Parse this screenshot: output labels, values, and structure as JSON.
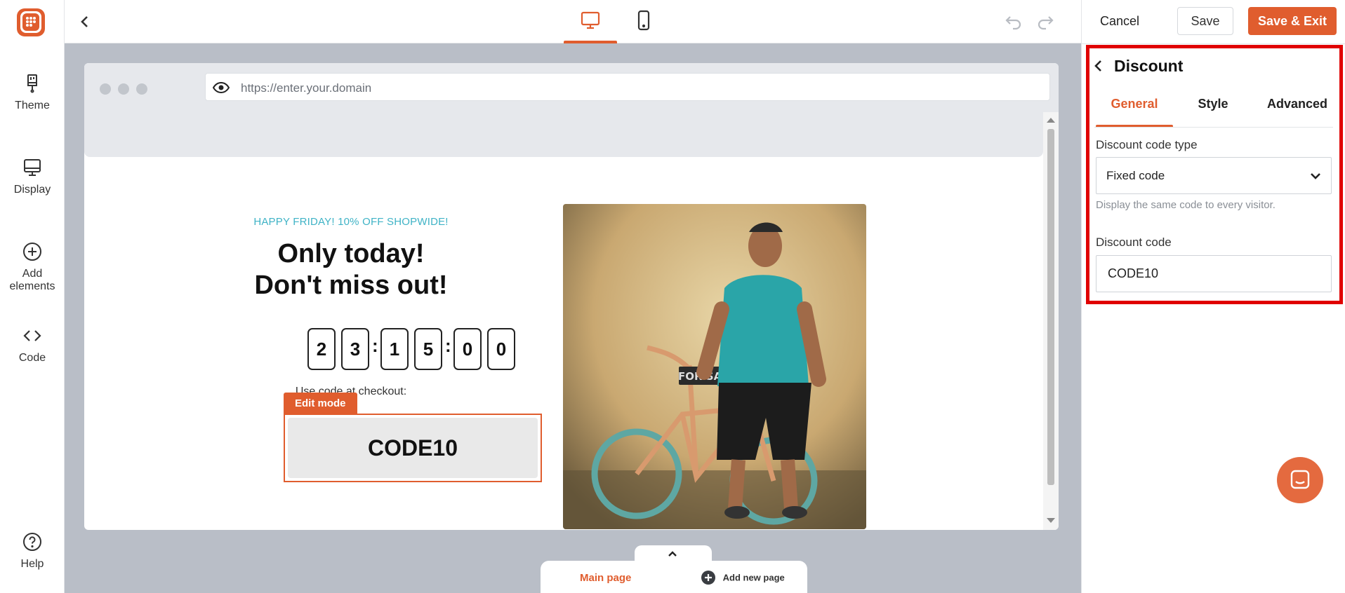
{
  "sidebar": {
    "items": [
      {
        "label": "Theme",
        "icon": "paintbrush-icon"
      },
      {
        "label": "Display",
        "icon": "monitor-icon"
      },
      {
        "label": "Add elements",
        "label_line1": "Add",
        "label_line2": "elements",
        "icon": "plus-circle-icon"
      },
      {
        "label": "Code",
        "icon": "code-icon"
      }
    ],
    "help": {
      "label": "Help",
      "icon": "question-circle-icon"
    }
  },
  "topbar": {
    "devices": [
      {
        "name": "desktop",
        "icon": "desktop-icon",
        "active": true
      },
      {
        "name": "mobile",
        "icon": "mobile-icon",
        "active": false
      }
    ]
  },
  "preview": {
    "url": "https://enter.your.domain",
    "popup": {
      "kicker": "HAPPY FRIDAY! 10% OFF SHOPWIDE!",
      "title_line1": "Only today!",
      "title_line2": "Don't miss out!",
      "countdown": [
        "2",
        "3",
        "1",
        "5",
        "0",
        "0"
      ],
      "countdown_separator": ":",
      "checkout_text": "Use code at checkout:",
      "edit_badge": "Edit mode",
      "code": "CODE10"
    },
    "pages": {
      "main": "Main page",
      "add": "Add new page"
    }
  },
  "actions": {
    "cancel": "Cancel",
    "save": "Save",
    "save_exit": "Save & Exit"
  },
  "panel": {
    "title": "Discount",
    "tabs": [
      {
        "label": "General",
        "active": true
      },
      {
        "label": "Style",
        "active": false
      },
      {
        "label": "Advanced",
        "active": false
      }
    ],
    "code_type_label": "Discount code type",
    "code_type_value": "Fixed code",
    "code_type_hint": "Display the same code to every visitor.",
    "code_label": "Discount code",
    "code_value": "CODE10"
  },
  "colors": {
    "accent": "#e05d2e",
    "highlight": "#e00000",
    "kicker": "#3fb3c6",
    "canvas": "#b9bec7"
  }
}
